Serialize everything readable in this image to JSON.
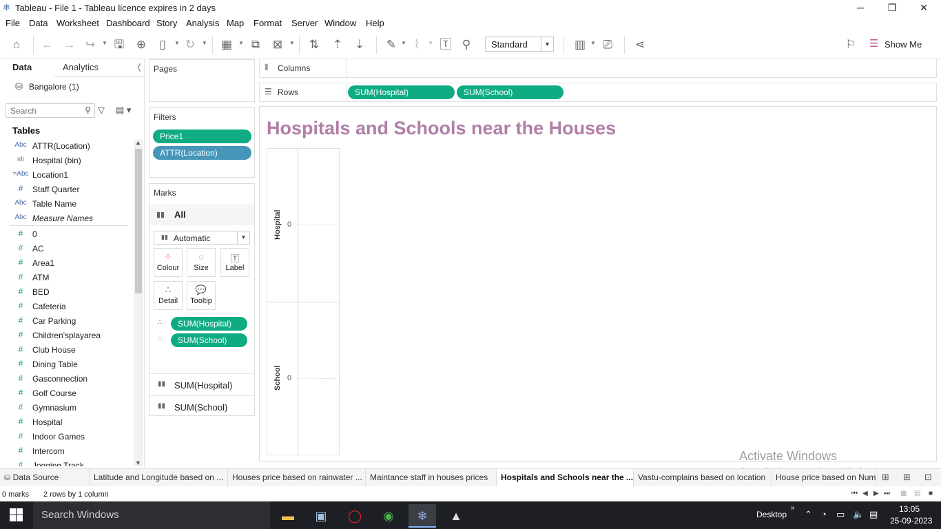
{
  "window": {
    "title": "Tableau - File 1 - Tableau licence expires in 2 days",
    "minimize": "─",
    "maximize": "❐",
    "close": "✕"
  },
  "menu": [
    "File",
    "Data",
    "Worksheet",
    "Dashboard",
    "Story",
    "Analysis",
    "Map",
    "Format",
    "Server",
    "Window",
    "Help"
  ],
  "toolbar": {
    "fit_value": "Standard",
    "show_me_label": "Show Me"
  },
  "left_pane": {
    "tab_data": "Data",
    "tab_analytics": "Analytics",
    "data_source": "Bangalore (1)",
    "search_placeholder": "Search",
    "tables_heading": "Tables",
    "dimensions": [
      {
        "icon": "Abc",
        "name": "ATTR(Location)"
      },
      {
        "icon": "ıılı",
        "name": "Hospital (bin)"
      },
      {
        "icon": "=Abc",
        "name": "Location1"
      },
      {
        "icon": "#",
        "name": "Staff Quarter"
      },
      {
        "icon": "Abc",
        "name": "Table Name"
      },
      {
        "icon": "Abc",
        "name": "Measure Names"
      }
    ],
    "measures": [
      {
        "icon": "#",
        "name": "0"
      },
      {
        "icon": "#",
        "name": "AC"
      },
      {
        "icon": "#",
        "name": "Area1"
      },
      {
        "icon": "#",
        "name": "ATM"
      },
      {
        "icon": "#",
        "name": "BED"
      },
      {
        "icon": "#",
        "name": "Cafeteria"
      },
      {
        "icon": "#",
        "name": "Car Parking"
      },
      {
        "icon": "#",
        "name": "Children'splayarea"
      },
      {
        "icon": "#",
        "name": "Club House"
      },
      {
        "icon": "#",
        "name": "Dining Table"
      },
      {
        "icon": "#",
        "name": "Gasconnection"
      },
      {
        "icon": "#",
        "name": "Golf Course"
      },
      {
        "icon": "#",
        "name": "Gymnasium"
      },
      {
        "icon": "#",
        "name": "Hospital"
      },
      {
        "icon": "#",
        "name": "Indoor Games"
      },
      {
        "icon": "#",
        "name": "Intercom"
      },
      {
        "icon": "#",
        "name": "Jogging Track"
      }
    ]
  },
  "pages_card": {
    "title": "Pages"
  },
  "filters_card": {
    "title": "Filters",
    "pills": [
      "Price1",
      "ATTR(Location)"
    ]
  },
  "marks_card": {
    "title": "Marks",
    "all_label": "All",
    "mark_type": "Automatic",
    "buttons": [
      "Colour",
      "Size",
      "Label",
      "Detail",
      "Tooltip"
    ],
    "pills": [
      "SUM(Hospital)",
      "SUM(School)"
    ],
    "measure_sections": [
      "SUM(Hospital)",
      "SUM(School)"
    ]
  },
  "shelves": {
    "columns_label": "Columns",
    "rows_label": "Rows",
    "row_pills": [
      "SUM(Hospital)",
      "SUM(School)"
    ]
  },
  "view": {
    "title": "Hospitals and Schools near the Houses",
    "title_color": "#b07fa7",
    "axes": [
      {
        "label": "Hospital",
        "tick": "0"
      },
      {
        "label": "School",
        "tick": "0"
      }
    ]
  },
  "watermark": {
    "line1": "Activate Windows",
    "line2": "Go to Settings to activate Windows."
  },
  "sheet_tabs": [
    "Data Source",
    "Latitude and Longitude based on ...",
    "Houses price based on rainwater ...",
    "Maintance staff in houses prices",
    "Hospitals and Schools near the ...",
    "Vastu-complains based on location",
    "House price based on Num"
  ],
  "active_sheet_index": 4,
  "status": {
    "marks": "0 marks",
    "rows_cols": "2 rows  by  1 column"
  },
  "taskbar": {
    "search_placeholder": "Search Windows",
    "desktop_label": "Desktop",
    "time": "13:05",
    "date": "25-09-2023"
  }
}
